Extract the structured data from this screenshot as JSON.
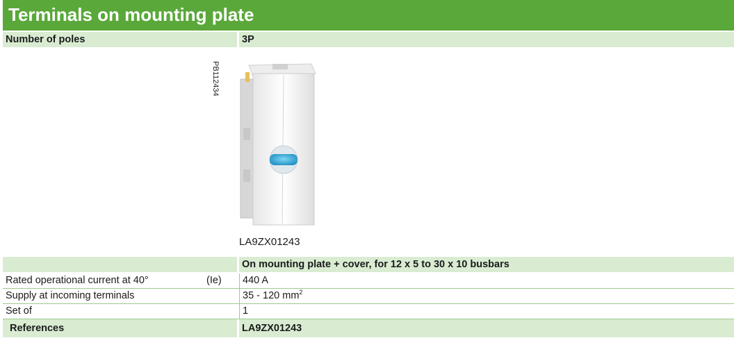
{
  "title": "Terminals on mounting plate",
  "header": {
    "label": "Number of poles",
    "value": "3P"
  },
  "image": {
    "ref_code": "PB112434",
    "caption": "LA9ZX01243"
  },
  "subheader": "On mounting plate + cover, for 12 x 5 to 30 x 10 busbars",
  "rows": [
    {
      "label": "Rated operational current at 40°",
      "unit": "(Ie)",
      "value": "440 A"
    },
    {
      "label": "Supply at incoming terminals",
      "value": "35 - 120 mm",
      "sup": "2"
    },
    {
      "label": "Set of",
      "value": "1"
    }
  ],
  "references": {
    "label": "References",
    "value": "LA9ZX01243"
  },
  "colors": {
    "accent": "#5aa83a",
    "shade": "#d9ecd2"
  }
}
